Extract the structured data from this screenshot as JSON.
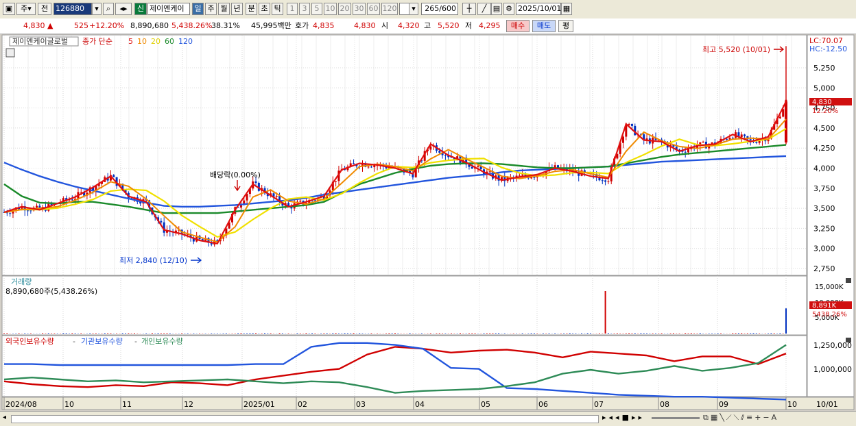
{
  "toolbar": {
    "market": "주",
    "prev": "전",
    "code": "126880",
    "new_badge": "신",
    "name": "제이엔케이",
    "periods": [
      "일",
      "주",
      "월",
      "년",
      "분",
      "초",
      "틱"
    ],
    "active_period": "일",
    "intervals": [
      "1",
      "3",
      "5",
      "10",
      "20",
      "30",
      "60",
      "120"
    ],
    "count": "265",
    "count_total": "/600",
    "date": "2025/10/01"
  },
  "quote": {
    "price": "4,830",
    "change": "525",
    "change_pct": "+12.20%",
    "volume": "8,890,680",
    "volume_pct": "5,438.26%",
    "turnover": "38.31%",
    "amount": "45,995백만",
    "bid_label": "호가",
    "bid1": "4,835",
    "bid2": "4,830",
    "open_label": "시",
    "open": "4,320",
    "high_label": "고",
    "high": "5,520",
    "low_label": "저",
    "low": "4,295",
    "buy": "매수",
    "sell": "매도",
    "eval": "평"
  },
  "price_panel": {
    "stock_label": "제이엔케이글로벌",
    "ma_label": "종가 단순",
    "ma_periods": [
      "5",
      "10",
      "20",
      "60",
      "120"
    ],
    "lc": "LC:70.07",
    "hc": "HC:-12.50",
    "high_annotation": "최고 5,520 (10/01)",
    "low_annotation": "최저 2,840 (12/10)",
    "dividend_annotation": "배당락(0.00%)",
    "current_price_tag": "4,830",
    "current_pct_tag": "12.20%"
  },
  "volume_panel": {
    "title": "거래량",
    "value": "8,890,680주(5,438.26%)",
    "current_tag": "8,891K",
    "current_pct_tag": "5438.26%",
    "axis_labels": [
      "15,000K",
      "10,000K",
      "5,000K"
    ]
  },
  "holding_panel": {
    "series": [
      "외국인보유수량",
      "기관보유수량",
      "개인보유수량"
    ],
    "separator": "-",
    "axis_labels": [
      "1,250,000",
      "1,000,000"
    ]
  },
  "time_axis": [
    "2024/08",
    "10",
    "11",
    "12",
    "2025/01",
    "02",
    "03",
    "04",
    "05",
    "06",
    "07",
    "08",
    "09",
    "10",
    "10/01"
  ],
  "chart_data": {
    "type": "line",
    "price_axis": {
      "ylim": [
        2750,
        5500
      ],
      "ticks": [
        "5,250",
        "5,000",
        "4,750",
        "4,500",
        "4,250",
        "4,000",
        "3,750",
        "3,500",
        "3,250",
        "3,000",
        "2,750"
      ]
    },
    "months_x": [
      "2024/08",
      "10",
      "11",
      "12",
      "2025/01",
      "02",
      "03",
      "04",
      "05",
      "06",
      "07",
      "08",
      "09",
      "10"
    ],
    "close": [
      3450,
      3520,
      3480,
      3560,
      3640,
      3760,
      3900,
      3650,
      3580,
      3230,
      3180,
      3100,
      3060,
      3480,
      3800,
      3660,
      3520,
      3580,
      3650,
      3980,
      4060,
      4040,
      4000,
      3930,
      4300,
      4160,
      4070,
      3950,
      3850,
      3890,
      3920,
      4000,
      3960,
      3900,
      3870,
      4550,
      4350,
      4330,
      4210,
      4280,
      4300,
      4420,
      4330,
      4390,
      4830
    ],
    "ma120": [
      4070,
      3980,
      3900,
      3830,
      3770,
      3720,
      3670,
      3620,
      3570,
      3530,
      3520,
      3520,
      3530,
      3540,
      3560,
      3580,
      3600,
      3630,
      3670,
      3700,
      3730,
      3760,
      3790,
      3820,
      3850,
      3880,
      3900,
      3920,
      3950,
      3970,
      3980,
      3990,
      4000,
      4010,
      4020,
      4040,
      4060,
      4080,
      4090,
      4100,
      4110,
      4120,
      4130,
      4140,
      4150
    ],
    "ma60": [
      3800,
      3650,
      3570,
      3560,
      3580,
      3580,
      3550,
      3520,
      3480,
      3440,
      3440,
      3440,
      3440,
      3460,
      3480,
      3500,
      3520,
      3540,
      3580,
      3690,
      3800,
      3870,
      3940,
      3990,
      4030,
      4050,
      4060,
      4060,
      4050,
      4030,
      4010,
      4000,
      4000,
      4010,
      4020,
      4060,
      4100,
      4140,
      4170,
      4190,
      4210,
      4230,
      4250,
      4270,
      4290
    ],
    "volume_label": "거래량",
    "volume_last_k": 8891,
    "volume_spikes": [
      {
        "month_index": 10,
        "value_k": 15000
      },
      {
        "month_index": 13,
        "value_k": 8891
      }
    ],
    "volume_axis": [
      "15,000K",
      "10,000K",
      "5,000K"
    ],
    "holdings": {
      "series_names": [
        "외국인보유수량",
        "기관보유수량",
        "개인보유수량"
      ],
      "foreign": [
        880,
        850,
        830,
        820,
        840,
        830,
        870,
        860,
        840,
        900,
        940,
        980,
        1010,
        1160,
        1240,
        1220,
        1180,
        1200,
        1210,
        1180,
        1130,
        1190,
        1170,
        1150,
        1090,
        1140,
        1140,
        1060,
        1170
      ],
      "institution": [
        1060,
        1060,
        1050,
        1050,
        1050,
        1050,
        1050,
        1050,
        1050,
        1060,
        1060,
        1240,
        1280,
        1280,
        1260,
        1220,
        1020,
        1010,
        810,
        800,
        780,
        760,
        740,
        730,
        720,
        720,
        710,
        700,
        690
      ],
      "individual": [
        900,
        920,
        900,
        880,
        890,
        870,
        880,
        890,
        900,
        880,
        860,
        880,
        870,
        820,
        760,
        780,
        790,
        800,
        830,
        870,
        960,
        1000,
        960,
        990,
        1040,
        990,
        1020,
        1070,
        1260
      ],
      "axis": [
        "1,250,000",
        "1,000,000"
      ]
    },
    "colors": {
      "ma5": "#e01010",
      "ma10": "#f08a00",
      "ma20": "#f0e000",
      "ma60": "#1a8a2a",
      "ma120": "#2255dd",
      "up": "#d00000",
      "down": "#0030c0",
      "foreign": "#d00000",
      "institution": "#2255dd",
      "individual": "#2e8b57"
    }
  }
}
